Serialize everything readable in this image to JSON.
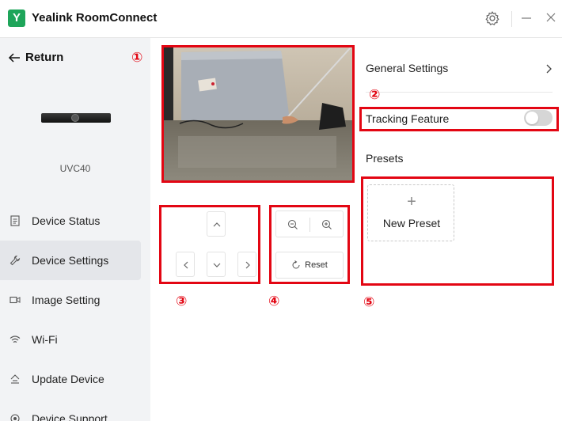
{
  "app": {
    "logo_letter": "Y",
    "title": "Yealink RoomConnect",
    "accent_color": "#1ea55a",
    "annotation_color": "#e30613"
  },
  "sidebar": {
    "back_label": "Return",
    "device_name": "UVC40",
    "items": [
      {
        "label": "Device Status",
        "icon": "document-icon",
        "active": false
      },
      {
        "label": "Device Settings",
        "icon": "wrench-icon",
        "active": true
      },
      {
        "label": "Image Setting",
        "icon": "video-camera-icon",
        "active": false
      },
      {
        "label": "Wi-Fi",
        "icon": "wifi-icon",
        "active": false
      },
      {
        "label": "Update Device",
        "icon": "upload-icon",
        "active": false
      },
      {
        "label": "Device Support",
        "icon": "support-icon",
        "active": false
      }
    ]
  },
  "controls": {
    "reset_label": "Reset"
  },
  "settings": {
    "general_label": "General Settings",
    "tracking_label": "Tracking Feature",
    "tracking_enabled": false,
    "presets_label": "Presets",
    "new_preset_plus": "+",
    "new_preset_label": "New Preset"
  },
  "annotations": [
    "①",
    "②",
    "③",
    "④",
    "⑤"
  ]
}
